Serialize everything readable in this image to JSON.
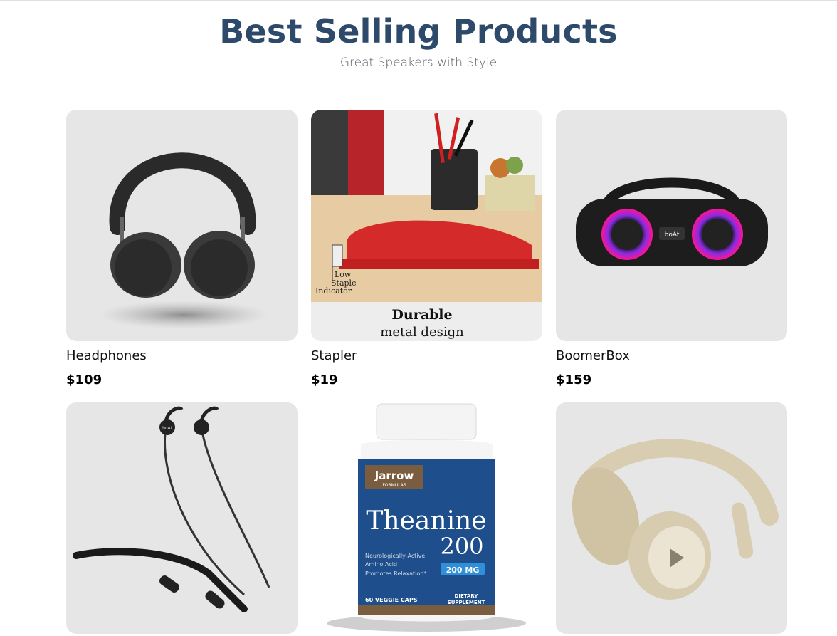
{
  "header": {
    "title": "Best Selling Products",
    "subtitle": "Great Speakers with Style"
  },
  "products": [
    {
      "name": "Headphones",
      "price": "$109",
      "image_icon": "black-headphones-icon"
    },
    {
      "name": "Stapler",
      "price": "$19",
      "image_icon": "red-stapler-icon",
      "image_text": {
        "indicator": [
          "Low",
          "Staple",
          "Indicator"
        ],
        "caption_bold": "Durable",
        "caption": "metal design"
      }
    },
    {
      "name": "BoomerBox",
      "price": "$159",
      "image_icon": "boombox-speaker-icon",
      "image_text": {
        "brand": "boAt"
      }
    },
    {
      "image_icon": "neckband-earphones-icon",
      "image_text": {
        "brand": "boAt"
      }
    },
    {
      "image_icon": "supplement-bottle-icon",
      "image_text": {
        "brand": "Jarrow",
        "brand_sub": "FORMULAS",
        "product": "Theanine",
        "dose_num": "200",
        "benefit1": "Neurologically-Active",
        "benefit2": "Amino Acid",
        "benefit3": "Promotes Relaxation*",
        "dose_badge": "200 MG",
        "count": "60 VEGGIE CAPS",
        "type1": "DIETARY",
        "type2": "SUPPLEMENT"
      }
    },
    {
      "image_icon": "beige-headphones-icon"
    }
  ],
  "colors": {
    "title": "#2e4a6b",
    "card_bg": "#e6e6e6",
    "stapler_red": "#d42a2a",
    "boombox_glow": "#e0208a",
    "bottle_label": "#1e4f8c"
  }
}
